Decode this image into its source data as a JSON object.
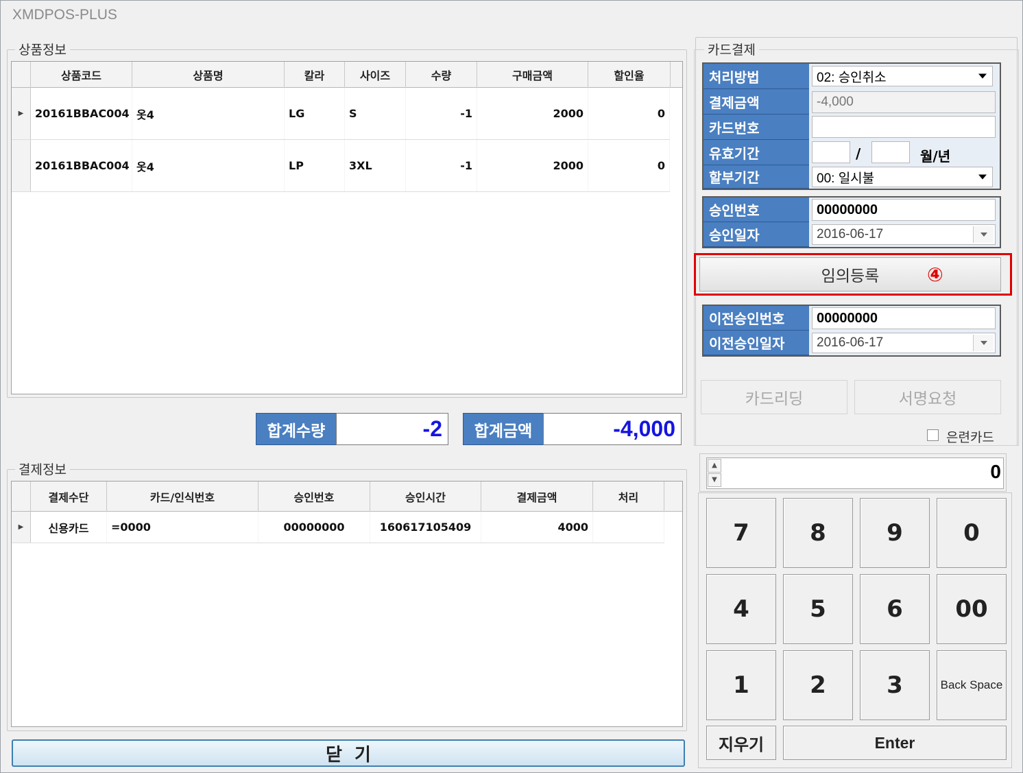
{
  "app": {
    "title": "XMDPOS-PLUS"
  },
  "product_group": {
    "legend": "상품정보",
    "columns": [
      "상품코드",
      "상품명",
      "칼라",
      "사이즈",
      "수량",
      "구매금액",
      "할인율"
    ],
    "rows": [
      {
        "code": "20161BBAC004",
        "name": "옷4",
        "color": "LG",
        "size": "S",
        "qty": "-1",
        "amount": "2000",
        "discount": "0"
      },
      {
        "code": "20161BBAC004",
        "name": "옷4",
        "color": "LP",
        "size": "3XL",
        "qty": "-1",
        "amount": "2000",
        "discount": "0"
      }
    ]
  },
  "summary": {
    "qty_label": "합계수량",
    "qty_value": "-2",
    "amount_label": "합계금액",
    "amount_value": "-4,000"
  },
  "payment_group": {
    "legend": "결제정보",
    "columns": [
      "결제수단",
      "카드/인식번호",
      "승인번호",
      "승인시간",
      "결제금액",
      "처리"
    ],
    "rows": [
      {
        "method": "신용카드",
        "card": "=0000",
        "approval": "00000000",
        "time": "160617105409",
        "amount": "4000",
        "process": ""
      }
    ]
  },
  "close_button": "닫  기",
  "card_payment": {
    "legend": "카드결제",
    "method_label": "처리방법",
    "method_value": "02: 승인취소",
    "amount_label": "결제금액",
    "amount_value": "-4,000",
    "cardno_label": "카드번호",
    "cardno_value": "",
    "expiry_label": "유효기간",
    "expiry_sep": "/",
    "expiry_suffix": "월/년",
    "installment_label": "할부기간",
    "installment_value": "00: 일시불",
    "approval_no_label": "승인번호",
    "approval_no_value": "00000000",
    "approval_date_label": "승인일자",
    "approval_date_value": "2016-06-17",
    "manual_register_button": "임의등록",
    "annotation_marker": "④",
    "prev_approval_no_label": "이전승인번호",
    "prev_approval_no_value": "00000000",
    "prev_approval_date_label": "이전승인일자",
    "prev_approval_date_value": "2016-06-17",
    "card_reading_button": "카드리딩",
    "signature_request_button": "서명요청",
    "training_card_label": "은련카드"
  },
  "keypad": {
    "display_value": "0",
    "keys": [
      "7",
      "8",
      "9",
      "0",
      "4",
      "5",
      "6",
      "00",
      "1",
      "2",
      "3",
      "Back Space"
    ],
    "clear_label": "지우기",
    "enter_label": "Enter"
  },
  "colors": {
    "label_blue": "#4a7fc1",
    "sum_value": "#1515e0",
    "highlight_red": "#e00000"
  }
}
